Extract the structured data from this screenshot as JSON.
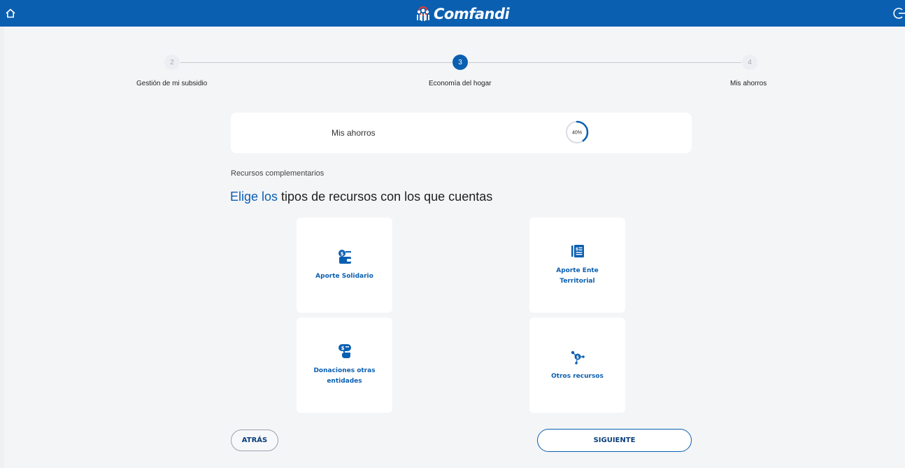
{
  "brand": {
    "name": "Comfandi",
    "logo_icon": "people-icon"
  },
  "header": {
    "home_icon": "home-icon",
    "logout_icon": "logout-icon"
  },
  "stepper": {
    "steps": [
      {
        "number": "2",
        "label": "Gestión de mi subsidio",
        "state": "inactive"
      },
      {
        "number": "3",
        "label": "Economía del hogar",
        "state": "active"
      },
      {
        "number": "4",
        "label": "Mis ahorros",
        "state": "inactive"
      }
    ]
  },
  "progress": {
    "label": "Mis ahorros",
    "value_text": "40%",
    "fraction": 0.4
  },
  "section": {
    "subtitle": "Recursos complementarios",
    "headline_accent": "Elige los",
    "headline_rest": " tipos de recursos con los que cuentas"
  },
  "options": [
    {
      "label": "Aporte Solidario",
      "icon": "wallet-money-icon"
    },
    {
      "label": "Aporte Ente Territorial",
      "icon": "money-document-icon"
    },
    {
      "label": "Donaciones otras entidades",
      "icon": "hand-money-icon"
    },
    {
      "label": "Otros recursos",
      "icon": "money-network-icon"
    }
  ],
  "buttons": {
    "back": "ATRÁS",
    "next": "SIGUIENTE"
  },
  "colors": {
    "primary": "#0b5fb0",
    "background": "#f4f5f7",
    "card": "#ffffff"
  }
}
